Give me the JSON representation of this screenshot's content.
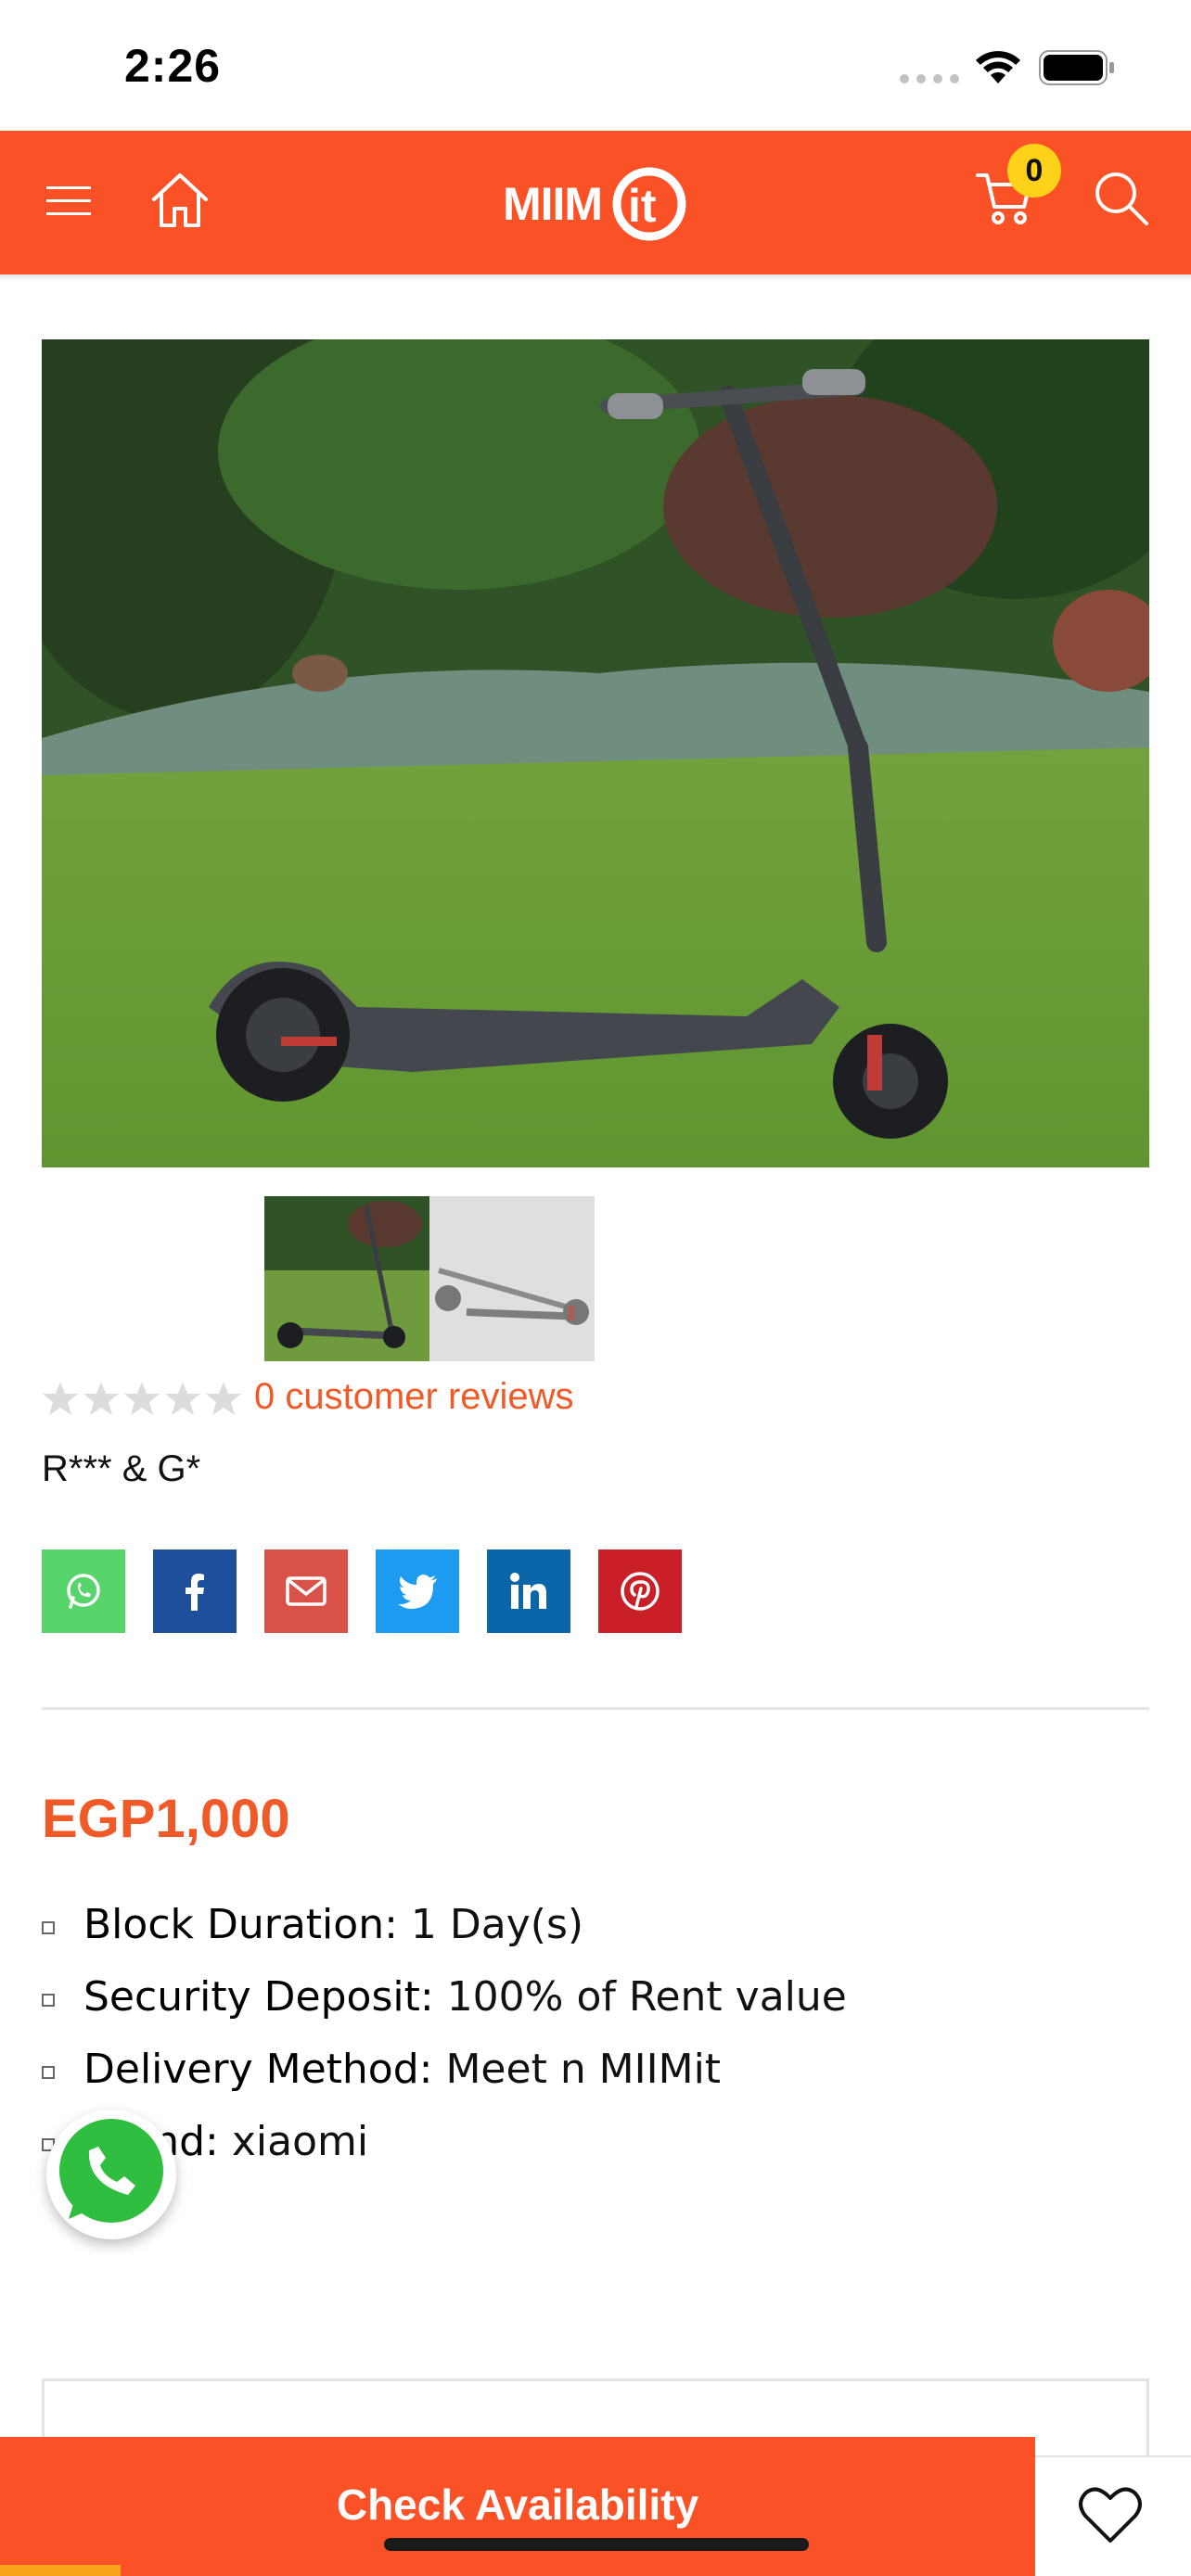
{
  "status_bar": {
    "time": "2:26"
  },
  "header": {
    "logo_text": "MIIMit",
    "cart_count": "0",
    "brand_color": "#fb5126",
    "icons": [
      "menu-icon",
      "home-icon",
      "cart-icon",
      "search-icon"
    ]
  },
  "product": {
    "image_alt": "Electric scooter on grass",
    "thumbnails": [
      "scooter-on-grass",
      "scooter-folded"
    ],
    "rating": {
      "stars": 0,
      "max": 5
    },
    "reviews_text": "0 customer reviews",
    "short_description": "R*** & G*",
    "share": [
      "whatsapp",
      "facebook",
      "email",
      "twitter",
      "linkedin",
      "pinterest"
    ],
    "share_colors": {
      "whatsapp": "#57d46a",
      "facebook": "#1e4f9c",
      "email": "#d9524a",
      "twitter": "#1d9bf0",
      "linkedin": "#0a66a8",
      "pinterest": "#cb1f27"
    },
    "price": "EGP1,000",
    "attributes": [
      {
        "label": "Block Duration:",
        "value": " 1 Day(s)"
      },
      {
        "label": "Security Deposit:",
        "value": " 100% of Rent value"
      },
      {
        "label": "Delivery Method:",
        "value": " Meet n MIIMit"
      },
      {
        "label": "Brand:",
        "value": " xiaomi"
      }
    ]
  },
  "actions": {
    "check_availability": "Check Availability"
  }
}
